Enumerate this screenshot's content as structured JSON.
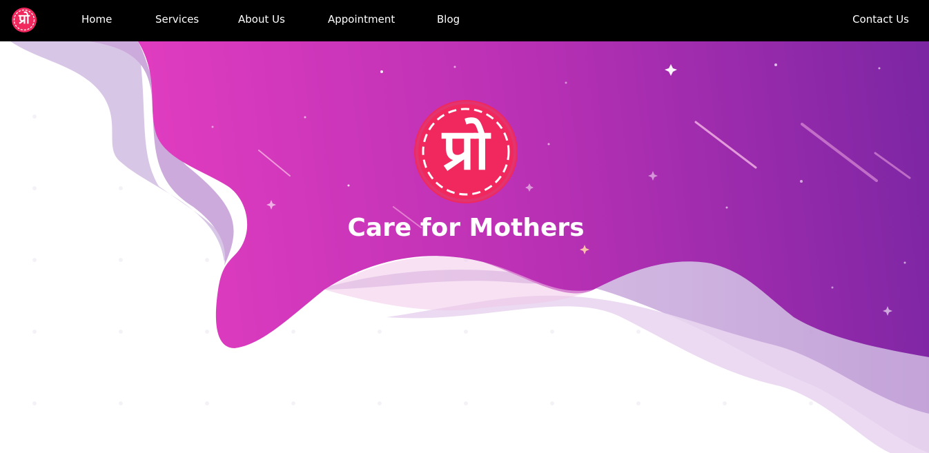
{
  "nav": {
    "logo_text": "प्रो",
    "links": [
      "Home",
      "Services",
      "About Us",
      "Appointment",
      "Blog"
    ],
    "contact": "Contact Us"
  },
  "hero": {
    "logo_text": "प्रो",
    "title": "Care for Mothers"
  },
  "colors": {
    "nav_background": "#000000",
    "logo_red": "#f0285e",
    "gradient_start": "#e03cc0",
    "gradient_end": "#7c26a4",
    "text": "#ffffff"
  }
}
